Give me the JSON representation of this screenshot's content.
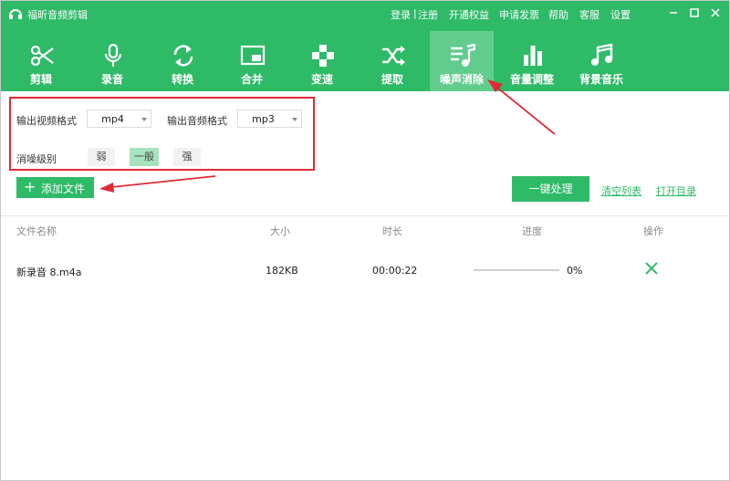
{
  "app": {
    "title": "福昕音频剪辑",
    "menu": [
      "登录",
      "|",
      "注册",
      "开通权益",
      "申请发票",
      "帮助",
      "客服",
      "设置"
    ]
  },
  "toolbar": [
    {
      "label": "剪辑",
      "icon": "scissors-icon"
    },
    {
      "label": "录音",
      "icon": "microphone-icon"
    },
    {
      "label": "转换",
      "icon": "convert-icon"
    },
    {
      "label": "合并",
      "icon": "merge-icon"
    },
    {
      "label": "变速",
      "icon": "speed-icon"
    },
    {
      "label": "提取",
      "icon": "extract-icon"
    },
    {
      "label": "噪声消除",
      "icon": "noise-removal-icon",
      "active": true
    },
    {
      "label": "音量调整",
      "icon": "volume-icon"
    },
    {
      "label": "背景音乐",
      "icon": "music-note-icon"
    }
  ],
  "settings": {
    "video_format_label": "输出视频格式",
    "video_format_value": "mp4",
    "audio_format_label": "输出音频格式",
    "audio_format_value": "mp3",
    "denoise_label": "消噪级别",
    "levels": [
      "弱",
      "一般",
      "强"
    ],
    "selected_level": "一般"
  },
  "actions": {
    "add_file": "添加文件",
    "process": "一键处理",
    "clear_list": "清空列表",
    "open_dir": "打开目录"
  },
  "table": {
    "headers": [
      "文件名称",
      "大小",
      "时长",
      "进度",
      "操作"
    ],
    "rows": [
      {
        "name": "新录音 8.m4a",
        "size": "182KB",
        "duration": "00:00:22",
        "progress": "0%",
        "progress_value": 0
      }
    ]
  },
  "colors": {
    "primary": "#2fba68",
    "annotation": "#e02b35"
  }
}
